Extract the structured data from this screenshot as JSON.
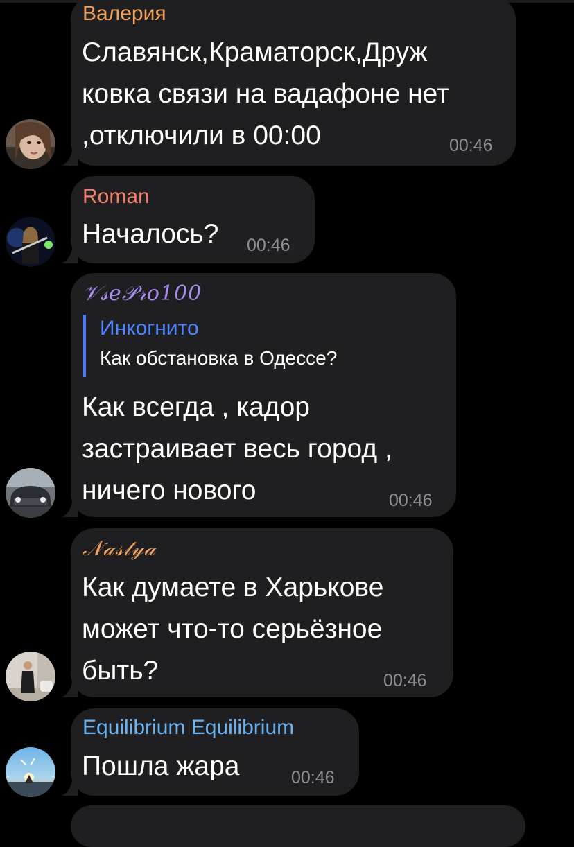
{
  "colors": {
    "background": "#000000",
    "bubble": "#1f1f21",
    "timestamp": "#8e8e93",
    "reply_accent": "#4e7bff"
  },
  "messages": [
    {
      "sender": "Валерия",
      "sender_color": "#f0a25c",
      "text": "Славянск,Краматорск,Друж\nковка связи на вадафоне нет\n,отключили в 00:00",
      "time": "00:46",
      "avatar_icon": "girl-portrait-avatar"
    },
    {
      "sender": "Roman",
      "sender_color": "#f47d6b",
      "text": "Началось?",
      "time": "00:46",
      "avatar_icon": "guitarist-on-stage-avatar"
    },
    {
      "sender": "𝒱𝓈𝑒𝒫𝓇𝑜100",
      "sender_color": "#a98cf0",
      "reply": {
        "name": "Инкогнито",
        "text": "Как обстановка в Одессе?"
      },
      "text": "Как всегда , кадор\nзастраивает весь город ,\nничего нового",
      "time": "00:46",
      "avatar_icon": "car-avatar"
    },
    {
      "sender": "𝒩𝒶𝓈𝓉𝓎𝒶",
      "sender_color": "#f0a25c",
      "text": "Как думаете в Харькове\nможет что-то серьёзное\nбыть?",
      "time": "00:46",
      "avatar_icon": "woman-in-room-avatar"
    },
    {
      "sender": "Equilibrium Equilibrium",
      "sender_color": "#6ab3f3",
      "text": "Пошла жара",
      "time": "00:46",
      "avatar_icon": "sunset-sky-avatar"
    }
  ]
}
